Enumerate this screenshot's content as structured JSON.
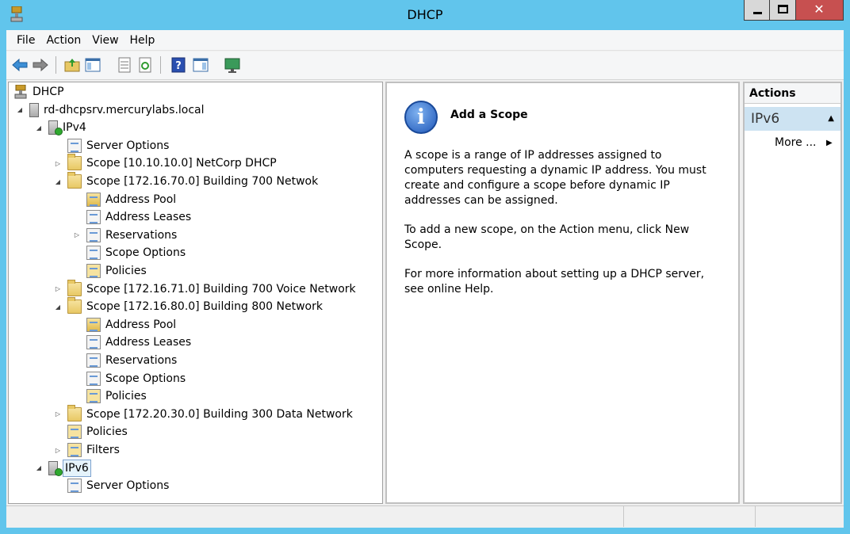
{
  "window": {
    "title": "DHCP"
  },
  "menubar": {
    "items": [
      "File",
      "Action",
      "View",
      "Help"
    ]
  },
  "toolbar": {
    "icons": [
      "back-arrow-icon",
      "forward-arrow-icon",
      "up-folder-icon",
      "show-tree-icon",
      "export-list-icon",
      "refresh-icon",
      "help-icon",
      "show-action-pane-icon",
      "monitor-icon"
    ]
  },
  "tree": {
    "items": [
      {
        "label": "DHCP",
        "level": 0,
        "icon": "dhcp-icon",
        "expander": ""
      },
      {
        "label": "rd-dhcpsrv.mercurylabs.local",
        "level": 1,
        "icon": "server-icon",
        "expander": "expanded"
      },
      {
        "label": "IPv4",
        "level": 2,
        "icon": "ipv4-server-icon",
        "expander": "expanded"
      },
      {
        "label": "Server Options",
        "level": 3,
        "icon": "options-icon",
        "expander": ""
      },
      {
        "label": "Scope [10.10.10.0] NetCorp DHCP",
        "level": 3,
        "icon": "folder-icon",
        "expander": "collapsed"
      },
      {
        "label": "Scope [172.16.70.0] Building 700 Netwok",
        "level": 3,
        "icon": "folder-icon",
        "expander": "expanded"
      },
      {
        "label": "Address Pool",
        "level": 4,
        "icon": "address-pool-icon",
        "expander": ""
      },
      {
        "label": "Address Leases",
        "level": 4,
        "icon": "address-leases-icon",
        "expander": ""
      },
      {
        "label": "Reservations",
        "level": 4,
        "icon": "reservations-icon",
        "expander": "collapsed"
      },
      {
        "label": "Scope Options",
        "level": 4,
        "icon": "options-icon",
        "expander": ""
      },
      {
        "label": "Policies",
        "level": 4,
        "icon": "policies-icon",
        "expander": ""
      },
      {
        "label": "Scope [172.16.71.0] Building 700 Voice Network",
        "level": 3,
        "icon": "folder-icon",
        "expander": "collapsed"
      },
      {
        "label": "Scope [172.16.80.0] Building 800 Network",
        "level": 3,
        "icon": "folder-icon",
        "expander": "expanded"
      },
      {
        "label": "Address Pool",
        "level": 4,
        "icon": "address-pool-icon",
        "expander": ""
      },
      {
        "label": "Address Leases",
        "level": 4,
        "icon": "address-leases-icon",
        "expander": ""
      },
      {
        "label": "Reservations",
        "level": 4,
        "icon": "reservations-icon",
        "expander": ""
      },
      {
        "label": "Scope Options",
        "level": 4,
        "icon": "options-icon",
        "expander": ""
      },
      {
        "label": "Policies",
        "level": 4,
        "icon": "policies-icon",
        "expander": ""
      },
      {
        "label": "Scope [172.20.30.0] Building 300 Data Network",
        "level": 3,
        "icon": "folder-icon",
        "expander": "collapsed"
      },
      {
        "label": "Policies",
        "level": 3,
        "icon": "policies-icon",
        "expander": ""
      },
      {
        "label": "Filters",
        "level": 3,
        "icon": "filters-icon",
        "expander": "collapsed"
      },
      {
        "label": "IPv6",
        "level": 2,
        "icon": "ipv6-server-icon",
        "expander": "expanded",
        "selected": true
      },
      {
        "label": "Server Options",
        "level": 3,
        "icon": "options-icon",
        "expander": ""
      }
    ]
  },
  "result": {
    "title": "Add a Scope",
    "para1": "A scope is a range of IP addresses assigned to computers requesting a dynamic IP address. You must create and configure a scope before dynamic IP addresses can be assigned.",
    "para2": "To add a new scope, on the Action menu, click New Scope.",
    "para3": "For more information about setting up a DHCP server, see online Help."
  },
  "actions": {
    "header": "Actions",
    "group": "IPv6",
    "more": "More ..."
  },
  "colors": {
    "titlebar": "#61c5ec",
    "close_button": "#c75050",
    "selection": "#e5f3fb",
    "actions_group": "#cde3f2"
  }
}
